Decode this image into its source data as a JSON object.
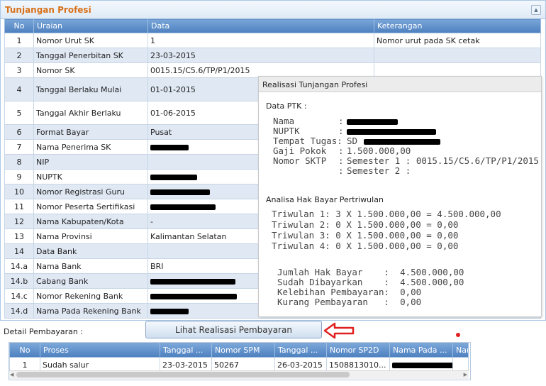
{
  "panel": {
    "title": "Tunjangan Profesi"
  },
  "table": {
    "headers": [
      "No",
      "Uraian",
      "Data",
      "Keterangan"
    ],
    "rows": [
      {
        "no": "1",
        "uraian": "Nomor Urut SK",
        "data": "1",
        "ket": "Nomor urut pada SK cetak"
      },
      {
        "no": "2",
        "uraian": "Tanggal Penerbitan SK",
        "data": "23-03-2015",
        "ket": ""
      },
      {
        "no": "3",
        "uraian": "Nomor SK",
        "data": "0015.15/C5.6/TP/P1/2015",
        "ket": ""
      },
      {
        "no": "4",
        "uraian": "Tanggal Berlaku Mulai",
        "data": "01-01-2015",
        "ket": ""
      },
      {
        "no": "5",
        "uraian": "Tanggal Akhir Berlaku",
        "data": "01-06-2015",
        "ket": ""
      },
      {
        "no": "6",
        "uraian": "Format Bayar",
        "data": "Pusat",
        "ket": ""
      },
      {
        "no": "7",
        "uraian": "Nama Penerima SK",
        "data": "",
        "ket": ""
      },
      {
        "no": "8",
        "uraian": "NIP",
        "data": "",
        "ket": ""
      },
      {
        "no": "9",
        "uraian": "NUPTK",
        "data": "",
        "ket": ""
      },
      {
        "no": "10",
        "uraian": "Nomor Registrasi Guru",
        "data": "",
        "ket": ""
      },
      {
        "no": "11",
        "uraian": "Nomor Peserta Sertifikasi",
        "data": "",
        "ket": ""
      },
      {
        "no": "12",
        "uraian": "Nama Kabupaten/Kota",
        "data": "-",
        "ket": ""
      },
      {
        "no": "13",
        "uraian": "Nama Provinsi",
        "data": "Kalimantan Selatan",
        "ket": ""
      },
      {
        "no": "14",
        "uraian": "Data Bank",
        "data": "",
        "ket": ""
      },
      {
        "no": "14.a",
        "uraian": "Nama Bank",
        "data": "BRI",
        "ket": ""
      },
      {
        "no": "14.b",
        "uraian": "Cabang Bank",
        "data": "",
        "ket": ""
      },
      {
        "no": "14.c",
        "uraian": "Nomor Rekening Bank",
        "data": "",
        "ket": ""
      },
      {
        "no": "14.d",
        "uraian": "Nama Pada Rekening Bank",
        "data": "",
        "ket": ""
      }
    ]
  },
  "popup": {
    "title": "Realisasi Tunjangan Profesi",
    "data_ptk_label": "Data PTK :",
    "fields": [
      {
        "label": "Nama",
        "sep": ":",
        "value": ""
      },
      {
        "label": "NUPTK",
        "sep": ":",
        "value": ""
      },
      {
        "label": "Tempat Tugas:",
        "sep": "",
        "value": "SD"
      },
      {
        "label": "Gaji Pokok",
        "sep": ":",
        "value": "1.500.000,00"
      },
      {
        "label": "Nomor SKTP",
        "sep": ":",
        "value": "Semester 1 : 0015.15/C5.6/TP/P1/2015"
      },
      {
        "label": "",
        "sep": ":",
        "value": "Semester 2 :"
      }
    ],
    "analisa_label": "Analisa Hak Bayar Pertriwulan",
    "triwulan": [
      "Triwulan 1:  3 X 1.500.000,00 = 4.500.000,00",
      "Triwulan 2:  0 X 1.500.000,00 = 0,00",
      "Triwulan 3:  0 X 1.500.000,00 = 0,00",
      "Triwulan 4:  0 X 1.500.000,00 = 0,00"
    ],
    "summary": [
      "Jumlah Hak Bayar    :  4.500.000,00",
      "Sudah Dibayarkan    :  4.500.000,00",
      "Kelebihan Pembayaran:  0,00",
      "Kurang Pembayaran   :  0,00"
    ]
  },
  "detail": {
    "label": "Detail Pembayaran :",
    "button": "Lihat Realisasi Pembayaran",
    "headers": [
      "No",
      "Proses",
      "Tanggal ...",
      "Nomor SPM",
      "Tanggal ...",
      "Nomor SP2D",
      "Nama Pada ...",
      "Nama Pada ..."
    ],
    "rows": [
      {
        "no": "1",
        "proses": "Sudah salur",
        "tgl1": "23-03-2015",
        "spm": "50267",
        "tgl2": "26-03-2015",
        "sp2d": "1508813010...",
        "nama1": "",
        "nama2": ""
      }
    ]
  },
  "colors": {
    "title": "#d8721a",
    "header": "#4d80bf",
    "alt_row": "#dfe8f3",
    "arrow": "#e02020"
  }
}
